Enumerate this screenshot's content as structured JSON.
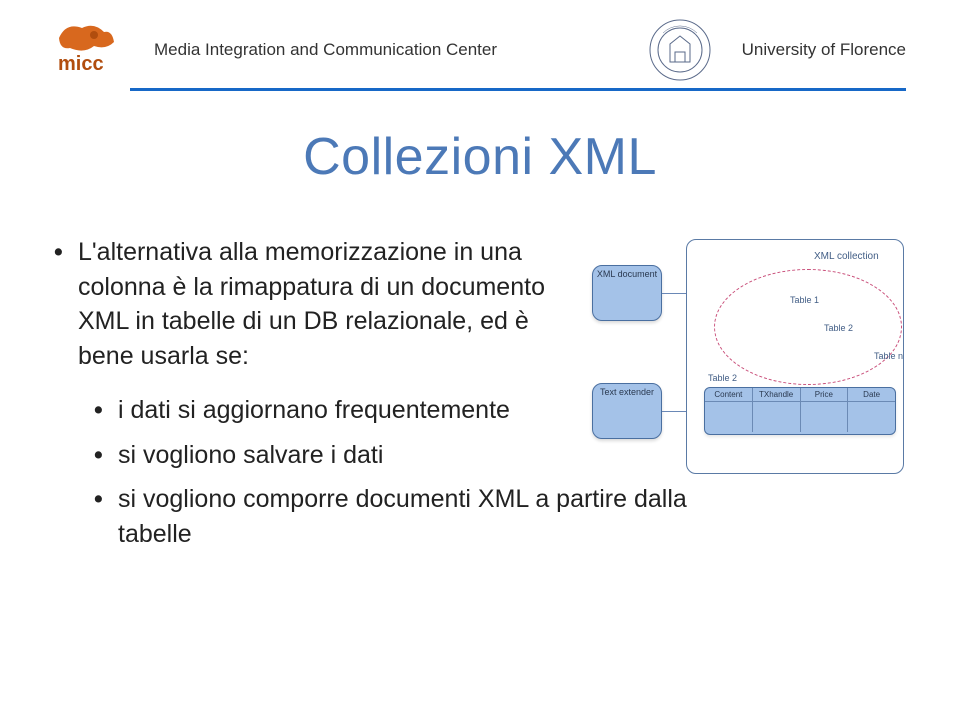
{
  "header": {
    "center_text": "Media Integration and Communication Center",
    "university": "University of Florence"
  },
  "title": "Collezioni XML",
  "bullets": {
    "main": "L'alternativa alla memorizzazione in una colonna è la rimappatura di un documento XML in tabelle di un DB relazionale, ed è bene usarla se:",
    "sub1": "i dati si aggiornano frequentemente",
    "sub2": "si vogliono salvare i dati",
    "sub3": "si vogliono comporre documenti XML a partire dalla tabelle"
  },
  "diagram": {
    "xml_doc": "XML document",
    "text_ext": "Text extender",
    "collection": "XML collection",
    "table1": "Table 1",
    "table2a": "Table 2",
    "table2b": "Table 2",
    "tablen": "Table n",
    "cols": {
      "c1": "Content",
      "c2": "TXhandle",
      "c3": "Price",
      "c4": "Date"
    }
  }
}
